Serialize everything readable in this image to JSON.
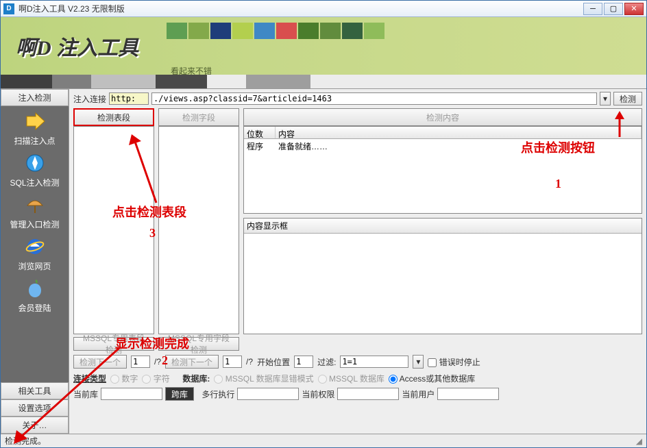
{
  "window": {
    "title": "啊D注入工具 V2.23 无限制版"
  },
  "banner": {
    "logo": "啊D 注入工具",
    "slogan": "看起来不错"
  },
  "sidebar": {
    "head": "注入检测",
    "items": [
      {
        "label": "扫描注入点"
      },
      {
        "label": "SQL注入检测"
      },
      {
        "label": "管理入口检测"
      },
      {
        "label": "浏览网页"
      },
      {
        "label": "会员登陆"
      }
    ],
    "foot": [
      {
        "label": "相关工具"
      },
      {
        "label": "设置选项"
      },
      {
        "label": "关于…"
      }
    ]
  },
  "url": {
    "label": "注入连接",
    "scheme": "http:",
    "path": "./views.asp?classid=7&articleid=1463",
    "detect_btn": "检测"
  },
  "cols": {
    "c1": {
      "tab": "检测表段",
      "mssql": "MSSQL专用表段检测"
    },
    "c2": {
      "tab": "检测字段",
      "mssql": "MSSQL专用字段检测"
    },
    "c3": {
      "tab": "检测内容",
      "headers": {
        "pos": "位数",
        "content": "内容"
      },
      "row": {
        "pos": "程序",
        "content": "准备就绪……"
      },
      "content_box": "内容显示框"
    }
  },
  "controls": {
    "prev": "检测下一个",
    "q": "?",
    "slash": "/?",
    "start_label": "开始位置",
    "start_val": "1",
    "filter_label": "过滤:",
    "filter_val": "1=1",
    "stop_on_error": "错误时停止"
  },
  "dbopts": {
    "conn_type": "连接类型",
    "num": "数字",
    "char": "字符",
    "db_label": "数据库:",
    "mssql_err": "MSSQL 数据库显错模式",
    "mssql_db": "MSSQL 数据库",
    "access": "Access或其他数据库"
  },
  "dbrow": {
    "cur_db": "当前库",
    "cross_db": "跨库",
    "multi_exec": "多行执行",
    "cur_priv": "当前权限",
    "cur_user": "当前用户"
  },
  "status": "检测完成。",
  "anno": {
    "a1": "点击检测按钮",
    "n1": "1",
    "a3": "点击检测表段",
    "n3": "3",
    "a2": "显示检测完成",
    "n2": "2"
  }
}
